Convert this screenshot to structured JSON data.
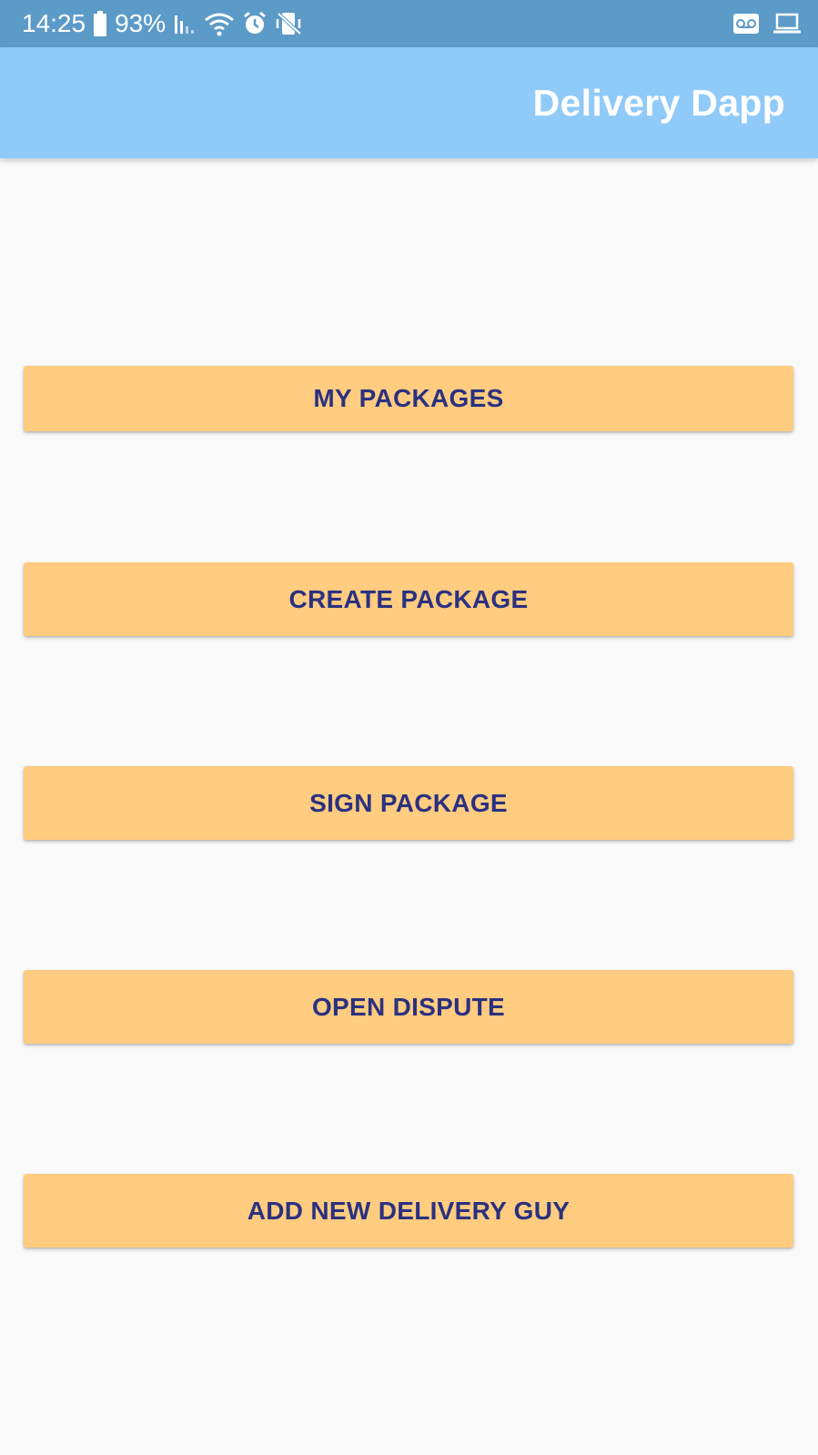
{
  "status_bar": {
    "time": "14:25",
    "battery_percent": "93%",
    "icons": [
      "battery-icon",
      "signal-icon",
      "wifi-icon",
      "alarm-icon",
      "vibrate-icon",
      "voicemail-icon",
      "laptop-icon"
    ]
  },
  "app_bar": {
    "title": "Delivery Dapp"
  },
  "menu": {
    "buttons": [
      {
        "label": "MY PACKAGES"
      },
      {
        "label": "CREATE PACKAGE"
      },
      {
        "label": "SIGN PACKAGE"
      },
      {
        "label": "OPEN DISPUTE"
      },
      {
        "label": "ADD NEW DELIVERY GUY"
      }
    ]
  },
  "colors": {
    "status_bar": "#5c9ac8",
    "app_bar": "#90caf9",
    "button_bg": "#ffcc80",
    "button_text": "#2b3180",
    "background": "#fafafa"
  }
}
